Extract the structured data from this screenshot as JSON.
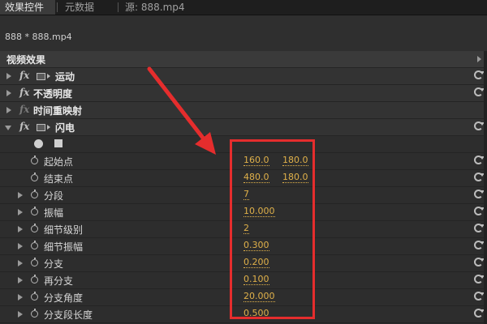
{
  "tabs": [
    {
      "label": "效果控件",
      "active": true,
      "close": "×"
    },
    {
      "label": "元数据",
      "active": false
    },
    {
      "label": "源: 888.mp4",
      "active": false
    }
  ],
  "breadcrumb": "888 * 888.mp4",
  "section_title": "视频效果",
  "effects": {
    "motion": "运动",
    "opacity": "不透明度",
    "time_remap": "时间重映射",
    "lightning": "闪电",
    "fx_label": "fx"
  },
  "params": [
    {
      "label": "起始点",
      "v1": "160.0",
      "v2": "180.0"
    },
    {
      "label": "结束点",
      "v1": "480.0",
      "v2": "180.0"
    },
    {
      "label": "分段",
      "v1": "7"
    },
    {
      "label": "振幅",
      "v1": "10.000"
    },
    {
      "label": "细节级别",
      "v1": "2"
    },
    {
      "label": "细节振幅",
      "v1": "0.300"
    },
    {
      "label": "分支",
      "v1": "0.200"
    },
    {
      "label": "再分支",
      "v1": "0.100"
    },
    {
      "label": "分支角度",
      "v1": "20.000"
    },
    {
      "label": "分支段长度",
      "v1": "0.500"
    }
  ],
  "colors": {
    "highlight": "#e52d2d",
    "value": "#e0b14a",
    "background": "#2b2b2b"
  },
  "icons": {
    "reset": "reset-icon",
    "stopwatch": "stopwatch-icon",
    "clip": "clip-icon"
  }
}
